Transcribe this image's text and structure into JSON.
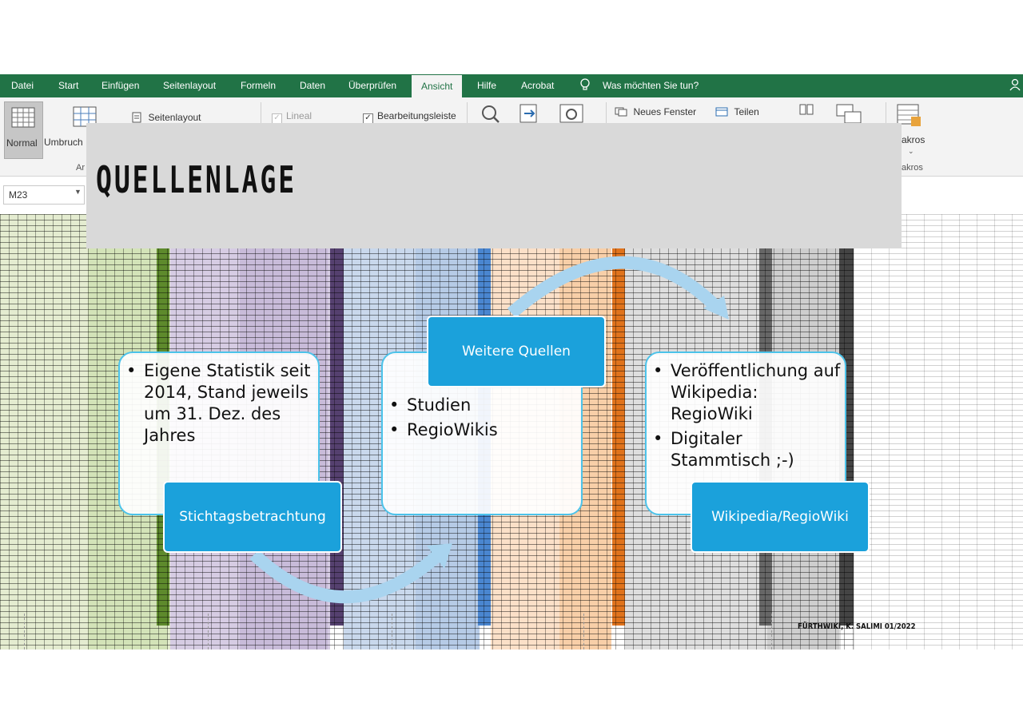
{
  "ribbon": {
    "tabs": [
      "Datei",
      "Start",
      "Einfügen",
      "Seitenlayout",
      "Formeln",
      "Daten",
      "Überprüfen",
      "Ansicht",
      "Hilfe",
      "Acrobat"
    ],
    "active_tab": "Ansicht",
    "tell_me": "Was möchten Sie tun?",
    "normal_label": "Normal",
    "umbruch_label": "Umbruch",
    "seitenlayout_label": "Seitenlayout",
    "lineal_label": "Lineal",
    "bearbeitungsleiste_label": "Bearbeitungsleiste",
    "neues_fenster_label": "Neues Fenster",
    "teilen_label": "Teilen",
    "makros_label": "akros",
    "makros_group_label": "akros",
    "ar_group_label": "Ar"
  },
  "formula_bar": {
    "name_box": "M23"
  },
  "slide": {
    "title": "QUELLENLAGE",
    "cards": [
      {
        "bullets": [
          "Eigene Statistik seit 2014, Stand jeweils um 31. Dez. des Jahres"
        ],
        "label": "Stichtagsbetrachtung"
      },
      {
        "bullets": [
          "Studien",
          "RegioWikis"
        ],
        "label": "Weitere Quellen"
      },
      {
        "bullets": [
          "Veröffentlichung auf Wikipedia: RegioWiki",
          "Digitaler Stammtisch ;-)"
        ],
        "label": "Wikipedia/RegioWiki"
      }
    ],
    "footer": "FÜRTHWIKI, K. SALIMI 01/2022"
  },
  "colors": {
    "excel_green": "#217346",
    "label_blue": "#1ba1db",
    "card_border": "#4cc3ea",
    "arrow": "#a9d4ef",
    "title_bg": "#d9d9d9"
  }
}
